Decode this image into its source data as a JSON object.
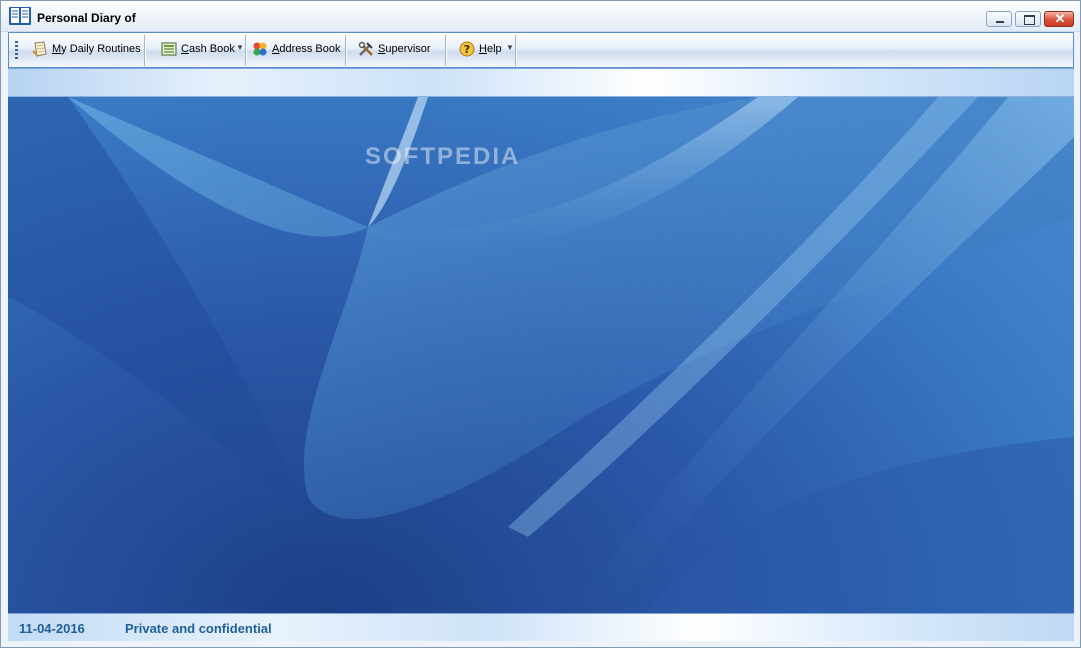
{
  "window": {
    "title": "Personal Diary of",
    "app_icon": "open-book-icon",
    "controls": {
      "minimize": "minimize-icon",
      "restore": "restore-icon",
      "close": "✕"
    }
  },
  "toolbar": {
    "items": [
      {
        "label": "My Daily Routines",
        "icon": "notepad-icon",
        "underline": "M",
        "dropdown": false
      },
      {
        "label": "Cash Book",
        "icon": "ledger-icon",
        "underline": "C",
        "dropdown": true
      },
      {
        "label": "Address Book",
        "icon": "people-icon",
        "underline": "A",
        "dropdown": false
      },
      {
        "label": "Supervisor",
        "icon": "tools-icon",
        "underline": "S",
        "dropdown": false
      },
      {
        "label": "Help",
        "icon": "question-icon",
        "underline": "H",
        "dropdown": true
      }
    ]
  },
  "watermark": "SOFTPEDIA",
  "statusbar": {
    "date": "11-04-2016",
    "message": "Private and confidential"
  },
  "colors": {
    "accent": "#1f5f9a",
    "toolbar_border": "#5b8bd0",
    "desktop_dark": "#1d3f86",
    "desktop_light": "#4a8cd0"
  }
}
